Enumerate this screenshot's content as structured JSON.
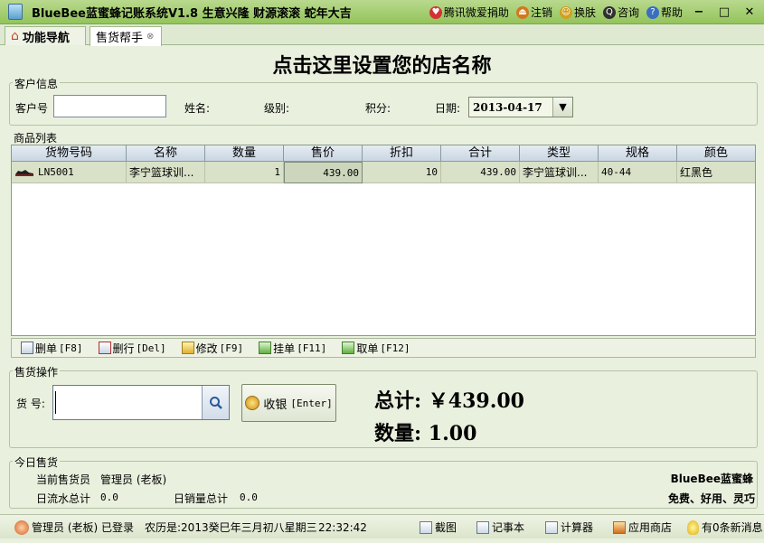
{
  "window": {
    "title": "BlueBee蓝蜜蜂记账系统V1.8 生意兴隆  财源滚滚  蛇年大吉",
    "links": [
      {
        "label": "腾讯微爱捐助",
        "icon": "heart-icon",
        "color": "#d83030"
      },
      {
        "label": "注销",
        "icon": "logout-icon",
        "color": "#d07a20"
      },
      {
        "label": "换肤",
        "icon": "skin-icon",
        "color": "#d0a020"
      },
      {
        "label": "咨询",
        "icon": "qq-icon",
        "color": "#303030"
      },
      {
        "label": "帮助",
        "icon": "help-icon",
        "color": "#3a6ec0"
      }
    ],
    "min": "−",
    "max": "□",
    "close": "✕"
  },
  "tabs": [
    {
      "label": "功能导航",
      "icon": "home-icon"
    },
    {
      "label": "售货帮手",
      "close": "⊗"
    }
  ],
  "shop_title": "点击这里设置您的店名称",
  "customer": {
    "legend": "客户信息",
    "id_label": "客户号",
    "id_value": "",
    "name_label": "姓名:",
    "level_label": "级别:",
    "points_label": "积分:",
    "date_label": "日期:",
    "date_value": "2013-04-17",
    "dropdown_icon": "chevron-down-icon"
  },
  "products": {
    "legend": "商品列表",
    "columns": [
      "货物号码",
      "名称",
      "数量",
      "售价",
      "折扣",
      "合计",
      "类型",
      "规格",
      "颜色"
    ],
    "rows": [
      {
        "code": "LN5001",
        "name": "李宁篮球训...",
        "qty": "1",
        "price": "439.00",
        "discount": "10",
        "total": "439.00",
        "type": "李宁篮球训...",
        "spec": "40-44",
        "color": "红黑色"
      }
    ]
  },
  "toolbar": [
    {
      "label": "删单",
      "key": "[F8]",
      "icon": "delete-order-icon"
    },
    {
      "label": "删行",
      "key": "[Del]",
      "icon": "delete-row-icon"
    },
    {
      "label": "修改",
      "key": "[F9]",
      "icon": "edit-icon"
    },
    {
      "label": "挂单",
      "key": "[F11]",
      "icon": "hold-order-icon"
    },
    {
      "label": "取单",
      "key": "[F12]",
      "icon": "retrieve-order-icon"
    }
  ],
  "sale": {
    "legend": "售货操作",
    "goods_label": "货 号:",
    "goods_value": "",
    "cashier_label": "收银",
    "cashier_key": "[Enter]",
    "total_label": "总计:",
    "total_value": "￥439.00",
    "qty_label": "数量:",
    "qty_value": "1.00"
  },
  "today": {
    "legend": "今日售货",
    "current_seller_label": "当前售货员",
    "current_seller_value": "管理员 (老板)",
    "cashflow_label": "日流水总计",
    "cashflow_value": "0.0",
    "sales_label": "日销量总计",
    "sales_value": "0.0",
    "brand": "BlueBee蓝蜜蜂",
    "slogan": "免费、好用、灵巧"
  },
  "status": {
    "user": "管理员 (老板) 已登录",
    "lunar": "农历是:2013癸巳年三月初八星期三",
    "time": "22:32:42",
    "screenshot": "截图",
    "notepad": "记事本",
    "calculator": "计算器",
    "appstore": "应用商店",
    "messages": "有0条新消息"
  }
}
